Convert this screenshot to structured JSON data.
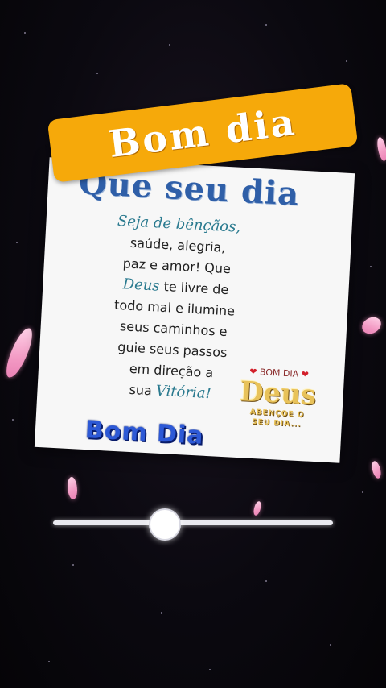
{
  "banner": {
    "text": "Bom dia"
  },
  "card": {
    "title": "Que seu dia",
    "lines": [
      "Seja de bênçãos,",
      "saúde, alegria,",
      "paz e amor! Que",
      "Deus",
      " te livre de",
      "todo mal e ilumine",
      "seus caminhos e",
      "guie seus passos",
      "em direção a",
      "sua ",
      "Vitória!"
    ],
    "bomdia_logo": "Bom Dia",
    "badge": {
      "top": "BOM DIA",
      "deus": "Deus",
      "sub1": "ABENÇOE O",
      "sub2": "SEU DIA..."
    }
  },
  "player": {
    "progress": 0.4
  }
}
